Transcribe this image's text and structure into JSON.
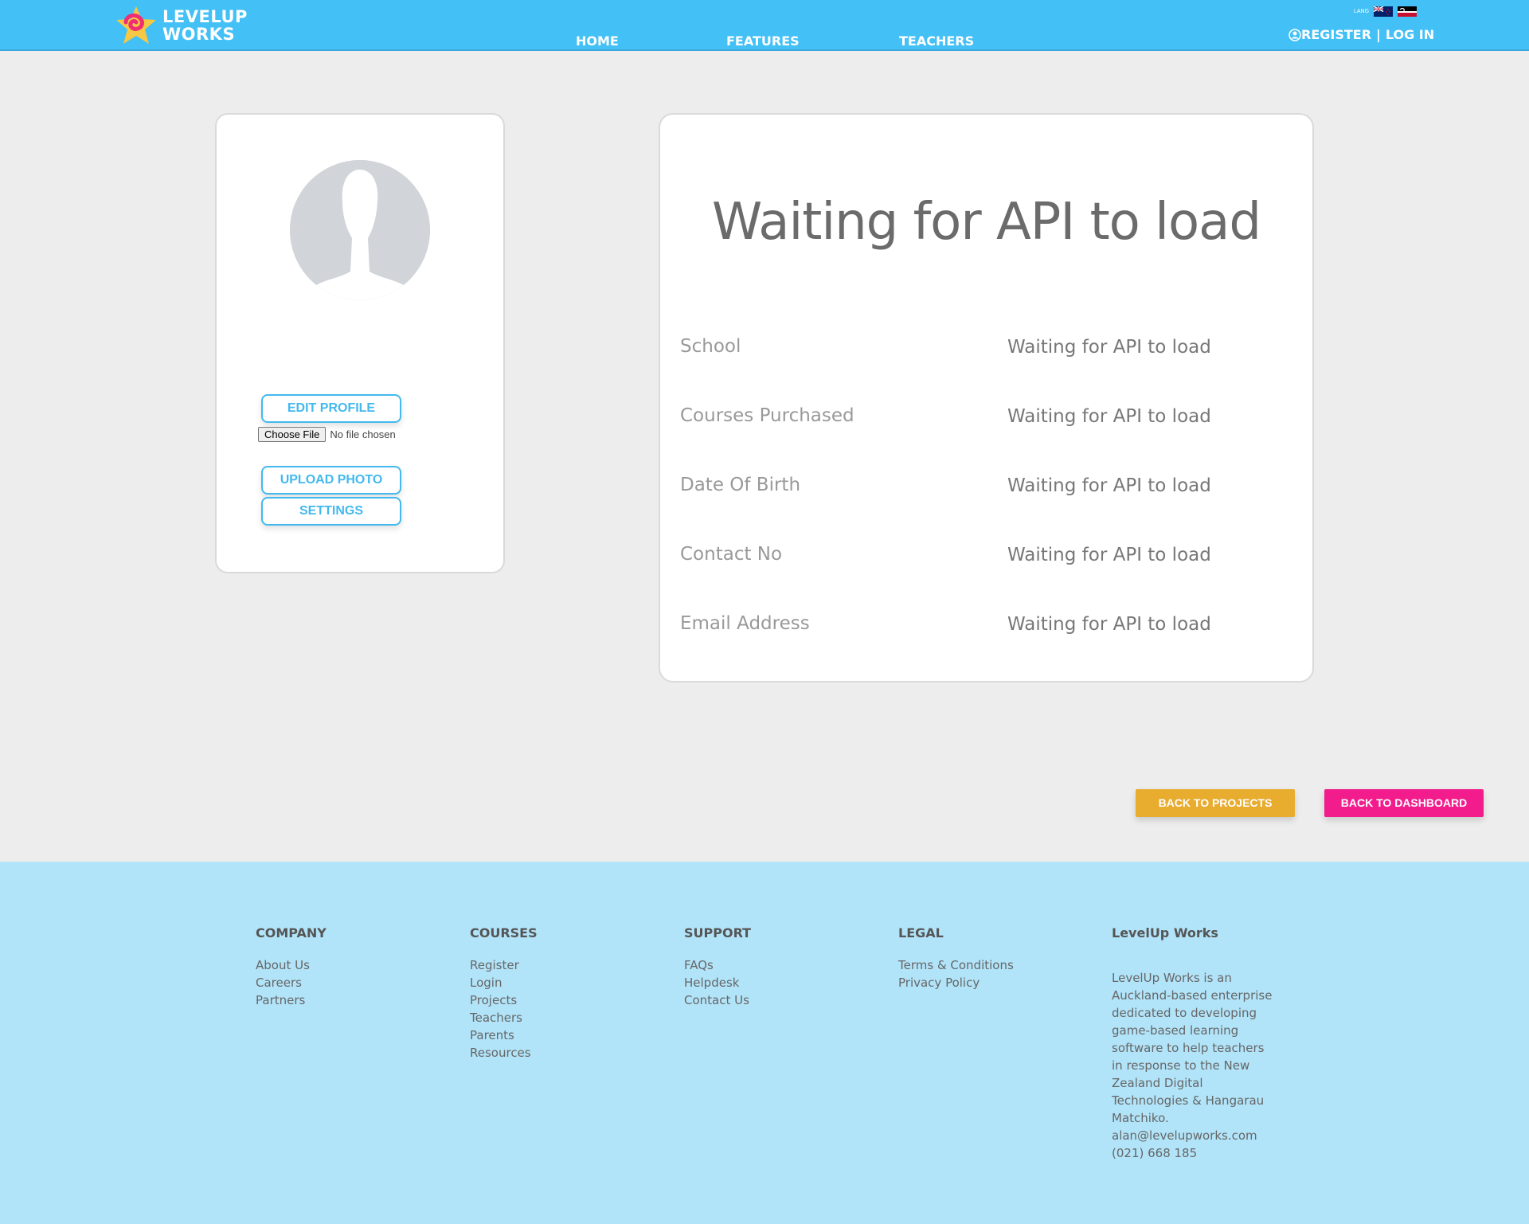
{
  "header": {
    "logo_line1": "LEVELUP",
    "logo_line2": "WORKS",
    "nav": [
      "HOME",
      "FEATURES",
      "TEACHERS"
    ],
    "lang_label": "LANG",
    "register": "REGISTER",
    "separator": "|",
    "login": "LOG IN",
    "colors": {
      "bar": "#43c0f6"
    }
  },
  "profile": {
    "edit_profile": "EDIT PROFILE",
    "choose_file": "Choose File",
    "no_file": "No file chosen",
    "upload_photo": "UPLOAD PHOTO",
    "settings": "SETTINGS"
  },
  "details": {
    "title": "Waiting for API to load",
    "rows": [
      {
        "label": "School",
        "value": "Waiting for API to load"
      },
      {
        "label": "Courses Purchased",
        "value": "Waiting for API to load"
      },
      {
        "label": "Date Of Birth",
        "value": "Waiting for API to load"
      },
      {
        "label": "Contact No",
        "value": "Waiting for API to load"
      },
      {
        "label": "Email Address",
        "value": "Waiting for API to load"
      }
    ]
  },
  "actions": {
    "back_to_projects": "BACK TO PROJECTS",
    "back_to_dashboard": "BACK TO DASHBOARD",
    "colors": {
      "projects": "#e8ac2f",
      "dashboard": "#f31c8c"
    }
  },
  "footer": {
    "company": {
      "heading": "COMPANY",
      "links": [
        "About Us",
        "Careers",
        "Partners"
      ]
    },
    "courses": {
      "heading": "COURSES",
      "links": [
        "Register",
        "Login",
        "Projects",
        "Teachers",
        "Parents",
        "Resources"
      ]
    },
    "support": {
      "heading": "SUPPORT",
      "links": [
        "FAQs",
        "Helpdesk",
        "Contact Us"
      ]
    },
    "legal": {
      "heading": "LEGAL",
      "links": [
        "Terms & Conditions",
        "Privacy Policy"
      ]
    },
    "about": {
      "heading": "LevelUp Works",
      "text": "LevelUp Works is an Auckland-based enterprise dedicated to developing game-based learning software to help teachers in response to the New Zealand Digital Technologies & Hangarau Matchiko.",
      "email": "alan@levelupworks.com",
      "phone": "(021) 668 185"
    }
  }
}
